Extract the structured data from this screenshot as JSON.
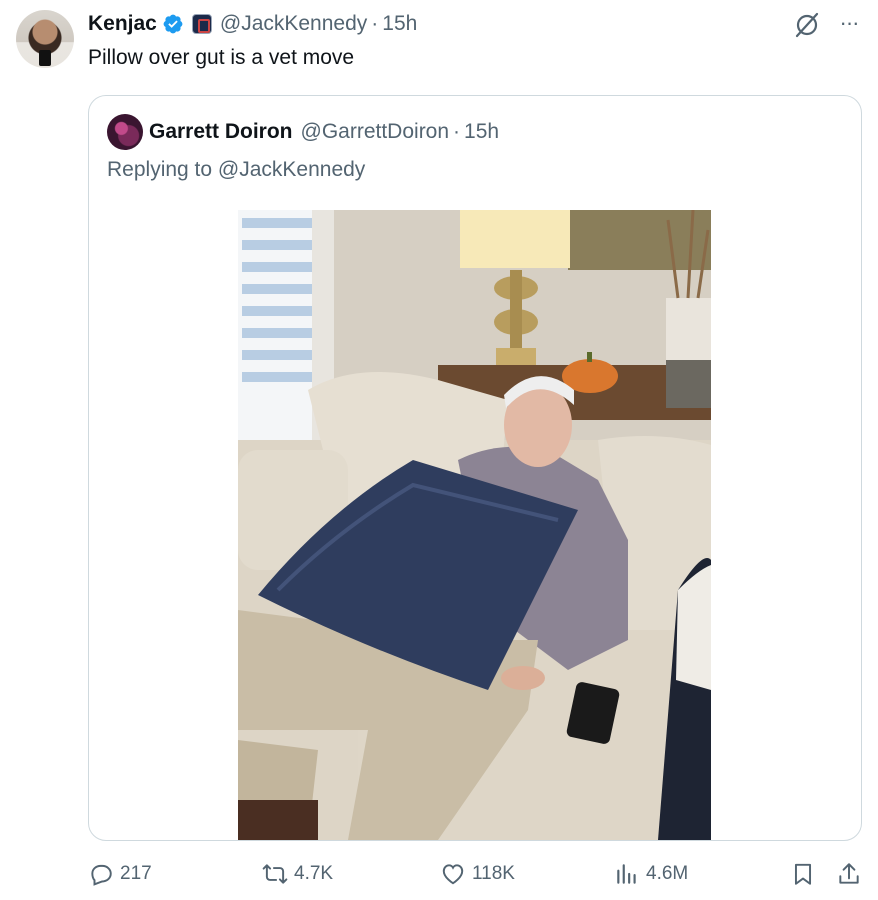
{
  "tweet": {
    "author_name": "Kenjac",
    "author_handle": "@JackKennedy",
    "time": "15h",
    "text": "Pillow over gut is a vet move"
  },
  "quoted_tweet": {
    "author_name": "Garrett Doiron",
    "author_handle": "@GarrettDoiron",
    "time": "15h",
    "reply_prefix": "Replying to",
    "reply_to": "@JackKennedy"
  },
  "actions": {
    "replies": "217",
    "reposts": "4.7K",
    "likes": "118K",
    "views": "4.6M"
  },
  "icons": {
    "verified": "verified-badge-icon",
    "grok": "grok-icon",
    "more": "more-icon",
    "reply": "reply-icon",
    "repost": "repost-icon",
    "like": "heart-icon",
    "views": "views-chart-icon",
    "bookmark": "bookmark-icon",
    "share": "share-icon"
  },
  "colors": {
    "verified": "#1d9bf0",
    "secondary_text": "#536471",
    "border": "#cfd9de"
  }
}
